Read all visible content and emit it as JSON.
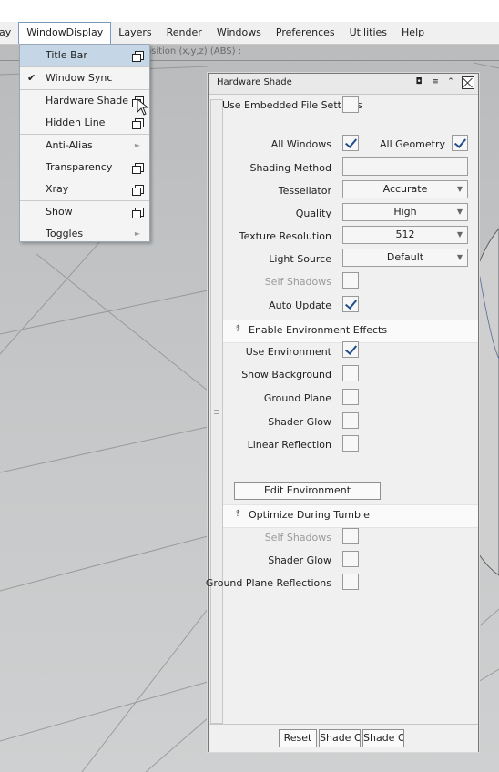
{
  "menubar": {
    "items": [
      {
        "label": "lay"
      },
      {
        "label": "WindowDisplay"
      },
      {
        "label": "Layers"
      },
      {
        "label": "Render"
      },
      {
        "label": "Windows"
      },
      {
        "label": "Preferences"
      },
      {
        "label": "Utilities"
      },
      {
        "label": "Help"
      }
    ]
  },
  "statusline": {
    "text": "osition (x,y,z) (ABS) :"
  },
  "dropdown": {
    "items": [
      {
        "label": "Title Bar"
      },
      {
        "label": "Window Sync",
        "checked": true
      },
      {
        "label": "Hardware Shade"
      },
      {
        "label": "Hidden Line"
      },
      {
        "label": "Anti-Alias"
      },
      {
        "label": "Transparency"
      },
      {
        "label": "Xray"
      },
      {
        "label": "Show"
      },
      {
        "label": "Toggles"
      }
    ],
    "check_glyph": "✔"
  },
  "panel": {
    "title": "Hardware Shade",
    "embedded_label": "Use Embedded File Settings",
    "all_windows_label": "All Windows",
    "all_geometry_label": "All Geometry",
    "shading_method_label": "Shading Method",
    "tessellator_label": "Tessellator",
    "tessellator_value": "Accurate",
    "quality_label": "Quality",
    "quality_value": "High",
    "texture_res_label": "Texture Resolution",
    "texture_res_value": "512",
    "light_source_label": "Light Source",
    "light_source_value": "Default",
    "self_shadows_label": "Self Shadows",
    "auto_update_label": "Auto Update",
    "env_section_label": "Enable Environment Effects",
    "use_env_label": "Use Environment",
    "show_bg_label": "Show Background",
    "ground_plane_label": "Ground Plane",
    "shader_glow_label": "Shader Glow",
    "linear_reflection_label": "Linear Reflection",
    "edit_env_label": "Edit Environment",
    "tumble_section_label": "Optimize During Tumble",
    "tumble_self_shadows_label": "Self Shadows",
    "tumble_shader_glow_label": "Shader Glow",
    "ground_plane_reflections_label": "Ground Plane Reflections",
    "reset_label": "Reset",
    "shade_off_label": "Shade Off",
    "shade_on_label": "Shade On",
    "section_icon": "⥉",
    "combo_arrow": "▼",
    "titlebar_icons": {
      "dock": "◘",
      "menu": "≡",
      "collapse": "⌃"
    }
  },
  "checkbox_state": {
    "embedded": false,
    "all_windows": true,
    "all_geometry": true,
    "self_shadows": false,
    "auto_update": true,
    "use_environment": true,
    "show_background": false,
    "ground_plane": false,
    "shader_glow": false,
    "linear_reflection": false,
    "tumble_self_shadows": false,
    "tumble_shader_glow": false,
    "ground_plane_reflections": false
  }
}
